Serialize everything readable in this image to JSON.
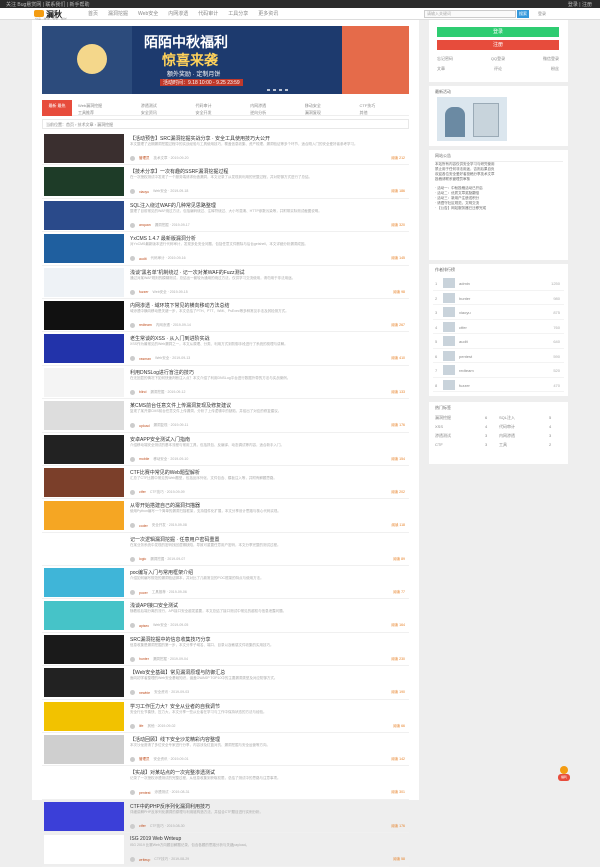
{
  "topbar": {
    "left_links": "关注 Bug悬赏网 | 联系我们 | 新手帮助",
    "right_links": "登录 | 注册"
  },
  "header": {
    "logo_name": "漏秋",
    "logo_sub": "分享 · 技术 · 安全 · 成长",
    "nav": [
      "首页",
      "漏洞挖掘",
      "Web安全",
      "内网渗透",
      "代码审计",
      "工具分享",
      "更多资讯"
    ],
    "search_placeholder": "请输入关键词",
    "search_button": "搜索",
    "login_link": "登录"
  },
  "banner": {
    "title_line1": "陌陌中秋福利",
    "title_line2": "惊喜来袭",
    "line3": "额外奖励 · 定制月饼",
    "line4": "活动时间：9.18 10:00 - 9.25 23:59"
  },
  "tabs": {
    "active": "最新 最热",
    "links": [
      "Web漏洞挖掘",
      "渗透测试",
      "代码审计",
      "内网渗透",
      "移动安全",
      "CTF技巧",
      "工具推荐",
      "安全资讯",
      "安全开发",
      "逆向分析",
      "漏洞复现",
      "其他"
    ]
  },
  "crumb": "当前位置：首页 › 技术文章 › 漏洞挖掘",
  "items": [
    {
      "title": "【活动预告】SRC漏洞挖掘实战分享 · 安全工具使用技巧大公开",
      "desc": "本文整理了近期漏洞挖掘过程中的实战经验与工具使用技巧，覆盖信息收集、资产梳理、漏洞验证等多个环节，适合刚入门的安全爱好者参考学习。",
      "author": "管理员",
      "meta": "技术文章 · 2019-09-20",
      "views": "阅读 212",
      "color": "#3a2f2f"
    },
    {
      "title": "【技术分享】一次有趣的SSRF漏洞挖掘过程",
      "desc": "在一次授权测试中发现了一个服务端请求伪造漏洞，本文记录了从发现到利用的完整过程，并对防御方式进行了总结。",
      "author": "xiaoyu",
      "meta": "Web安全 · 2019-09-18",
      "views": "阅读 186",
      "color": "#1e3c28"
    },
    {
      "title": "SQL注入绕过WAF的几种常见思路整理",
      "desc": "整理了目前常见的WAF绕过方法，包括编码绕过、注释符绕过、大小写混淆、HTTP参数污染等，并附带实际测试截图说明。",
      "author": "anquan",
      "meta": "漏洞挖掘 · 2019-09-17",
      "views": "阅读 320",
      "color": "#2a4a8a"
    },
    {
      "title": "YxCMS 1.4.7 最新版漏洞分析",
      "desc": "对YxCMS最新版本进行代码审计，发现多处安全问题，包括任意文件删除与后台getshell，本文详细分析漏洞成因。",
      "author": "audit",
      "meta": "代码审计 · 2019-09-16",
      "views": "阅读 145",
      "color": "#1f5f9f"
    },
    {
      "title": "浅谈“黑名单”机制绕过 · 记一次对某WAF的Fuzz测试",
      "desc": "通过对某WAF规则的模糊测试，总结出一套较为通用的绕过方法，仅供学习交流使用，请勿用于非法用途。",
      "author": "fuzzer",
      "meta": "Web安全 · 2019-09-15",
      "views": "阅读 98",
      "color": "#eef2f6"
    },
    {
      "title": "内网渗透 · 域环境下常见的横向移动方法总结",
      "desc": "域渗透中横向移动是关键一步，本文总结了PTH、PTT、WMI、PsExec等多种常见手法及其检测方式。",
      "author": "redteam",
      "meta": "内网渗透 · 2019-09-14",
      "views": "阅读 267",
      "color": "#111111"
    },
    {
      "title": "老生常谈的XSS · 从入门到进阶实战",
      "desc": "XSS作为最常见的Web漏洞之一，本文从原理、分类、利用方式到防御手段进行了系统的梳理与讲解。",
      "author": "xssman",
      "meta": "Web安全 · 2019-09-13",
      "views": "阅读 410",
      "color": "#2233aa"
    },
    {
      "title": "利用DNSLog进行盲注的技巧",
      "desc": "在无回显的情况下如何快速判断注入点？本文介绍了利用DNSLog平台进行数据外带的方法与实战案例。",
      "author": "blind",
      "meta": "漏洞挖掘 · 2019-09-12",
      "views": "阅读 133",
      "color": "#f4f4f4"
    },
    {
      "title": "某CMS前台任意文件上传漏洞复现及修复建议",
      "desc": "复现了某开源CMS前台任意文件上传漏洞，分析了上传逻辑中的缺陷，并给出了对应的修复建议。",
      "author": "upload",
      "meta": "漏洞复现 · 2019-09-11",
      "views": "阅读 176",
      "color": "#dddddd"
    },
    {
      "title": "安卓APP安全测试入门指南",
      "desc": "介绍移动端安全测试的基本流程与常用工具，包括抓包、反编译、动态调试等内容，适合新手入门。",
      "author": "mobile",
      "meta": "移动安全 · 2019-09-10",
      "views": "阅读 154",
      "color": "#222222"
    },
    {
      "title": "CTF比赛中常见的Web题型解析",
      "desc": "汇总了CTF比赛中常见的Web题型，包括反序列化、文件包含、模板注入等，并附有解题思路。",
      "author": "ctfer",
      "meta": "CTF技巧 · 2019-09-09",
      "views": "阅读 202",
      "color": "#7b3f2a"
    },
    {
      "title": "从零开始搭建自己的漏洞扫描器",
      "desc": "使用Python编写一个简单的漏洞扫描框架，支持插件化扩展，本文分享设计思路与核心代码实现。",
      "author": "coder",
      "meta": "安全开发 · 2019-09-08",
      "views": "阅读 118",
      "color": "#f5a623"
    },
    {
      "title": "记一次逻辑漏洞挖掘 · 任意用户密码重置",
      "desc": "在某业务系统中发现的密码找回逻辑缺陷，导致可重置任意用户密码，本文分享完整的测试过程。",
      "author": "logic",
      "meta": "漏洞挖掘 · 2019-09-07",
      "views": "阅读 89",
      "color": "#ffffff"
    },
    {
      "title": "poc编写入门与常用框架介绍",
      "desc": "介绍如何编写规范的漏洞验证脚本，并对比了几款常见的POC框架的特点与使用方法。",
      "author": "pocer",
      "meta": "工具推荐 · 2019-09-06",
      "views": "阅读 77",
      "color": "#3fb5d8"
    },
    {
      "title": "浅谈API接口安全测试",
      "desc": "随着前后端分离的流行，API接口安全越发重要，本文总结了接口测试中常见的越权与信息泄露问题。",
      "author": "apisec",
      "meta": "Web安全 · 2019-09-05",
      "views": "阅读 164",
      "color": "#46c3c8"
    },
    {
      "title": "SRC漏洞挖掘中的信息收集技巧分享",
      "desc": "信息收集是漏洞挖掘的第一步，本文分享子域名、端口、目录以及敏感文件收集的实用技巧。",
      "author": "hunter",
      "meta": "漏洞挖掘 · 2019-09-04",
      "views": "阅读 230",
      "color": "#1a1a1a"
    },
    {
      "title": "【Web安全基础】常见漏洞原理与防御汇总",
      "desc": "面向初学者整理的Web安全基础知识，涵盖OWASP TOP10中的主要漏洞类型及对应防御方式。",
      "author": "newbie",
      "meta": "安全资讯 · 2019-09-03",
      "views": "阅读 190",
      "color": "#222222"
    },
    {
      "title": "学习工作压力大？安全从业者的自我调节",
      "desc": "安全行业节奏快、压力大，本文分享一些从业者在学习与工作中保持状态的方法与经验。",
      "author": "life",
      "meta": "其他 · 2019-09-02",
      "views": "阅读 66",
      "color": "#f2c200"
    },
    {
      "title": "【活动回顾】线下安全沙龙精彩内容整理",
      "desc": "本次沙龙邀请了多位安全专家进行分享，内容涉及红蓝对抗、漏洞挖掘与安全运营等方向。",
      "author": "管理员",
      "meta": "安全资讯 · 2019-09-01",
      "views": "阅读 142",
      "color": "#cfcfcf"
    },
    {
      "title": "【实战】对某站点的一次完整渗透测试",
      "desc": "记录了一次授权渗透测试的完整过程，从信息收集到获取权限，总结了测试中的思路与注意事项。",
      "author": "pentest",
      "meta": "渗透测试 · 2019-08-31",
      "views": "阅读 301",
      "color": "#ffffff"
    },
    {
      "title": "CTF中的PHP反序列化漏洞利用技巧",
      "desc": "详细讲解PHP反序列化漏洞的原理与利用链构造方法，并结合CTF题目进行实例分析。",
      "author": "ctfer",
      "meta": "CTF技巧 · 2019-08-30",
      "views": "阅读 176",
      "color": "#3b3fd8"
    },
    {
      "title": "ISG 2019 Web Writeup",
      "desc": "ISG 2019 比赛Web方向题目解题记录，包含各题的思路分析与关键payload。",
      "author": "writeup",
      "meta": "CTF技巧 · 2019-08-29",
      "views": "阅读 58",
      "color": "#ffffff"
    }
  ],
  "sidebar": {
    "login_button": "登录",
    "register_button": "注册",
    "login_links": [
      "忘记密码",
      "QQ登录",
      "微信登录"
    ],
    "login_stats": [
      "文章",
      "评论",
      "粉丝"
    ],
    "ad_title": "最新活动",
    "notice_title": "网站公告",
    "notice_lines": [
      "本站所有内容仅供安全学习与研究使用",
      "禁止用于任何非法用途，否则后果自负",
      "欢迎各位安全爱好者投稿分享技术文章",
      "投稿请联系管理员审核"
    ],
    "notice_lines2": [
      "· 活动一：中秋投稿活动已开启",
      "· 活动二：优质文章奖励翻倍",
      "· 活动三：新用户注册送积分",
      "· 请遵守社区规范，文明交流",
      "· 【公告】网站服务器已迁移完成"
    ],
    "rank_title": "作者排行榜",
    "rank": [
      {
        "num": "1",
        "name": "admin",
        "score": "1250"
      },
      {
        "num": "2",
        "name": "hunter",
        "score": "980"
      },
      {
        "num": "3",
        "name": "xiaoyu",
        "score": "875"
      },
      {
        "num": "4",
        "name": "ctfer",
        "score": "760"
      },
      {
        "num": "5",
        "name": "audit",
        "score": "640"
      },
      {
        "num": "6",
        "name": "pentest",
        "score": "590"
      },
      {
        "num": "7",
        "name": "redteam",
        "score": "520"
      },
      {
        "num": "8",
        "name": "fuzzer",
        "score": "470"
      }
    ],
    "tags_title": "热门标签",
    "tags": [
      "漏洞挖掘",
      "6",
      "SQL注入",
      "5",
      "XSS",
      "4",
      "代码审计",
      "4",
      "渗透测试",
      "3",
      "内网渗透",
      "3",
      "CTF",
      "3",
      "工具",
      "2"
    ]
  },
  "fab_label": "福利"
}
